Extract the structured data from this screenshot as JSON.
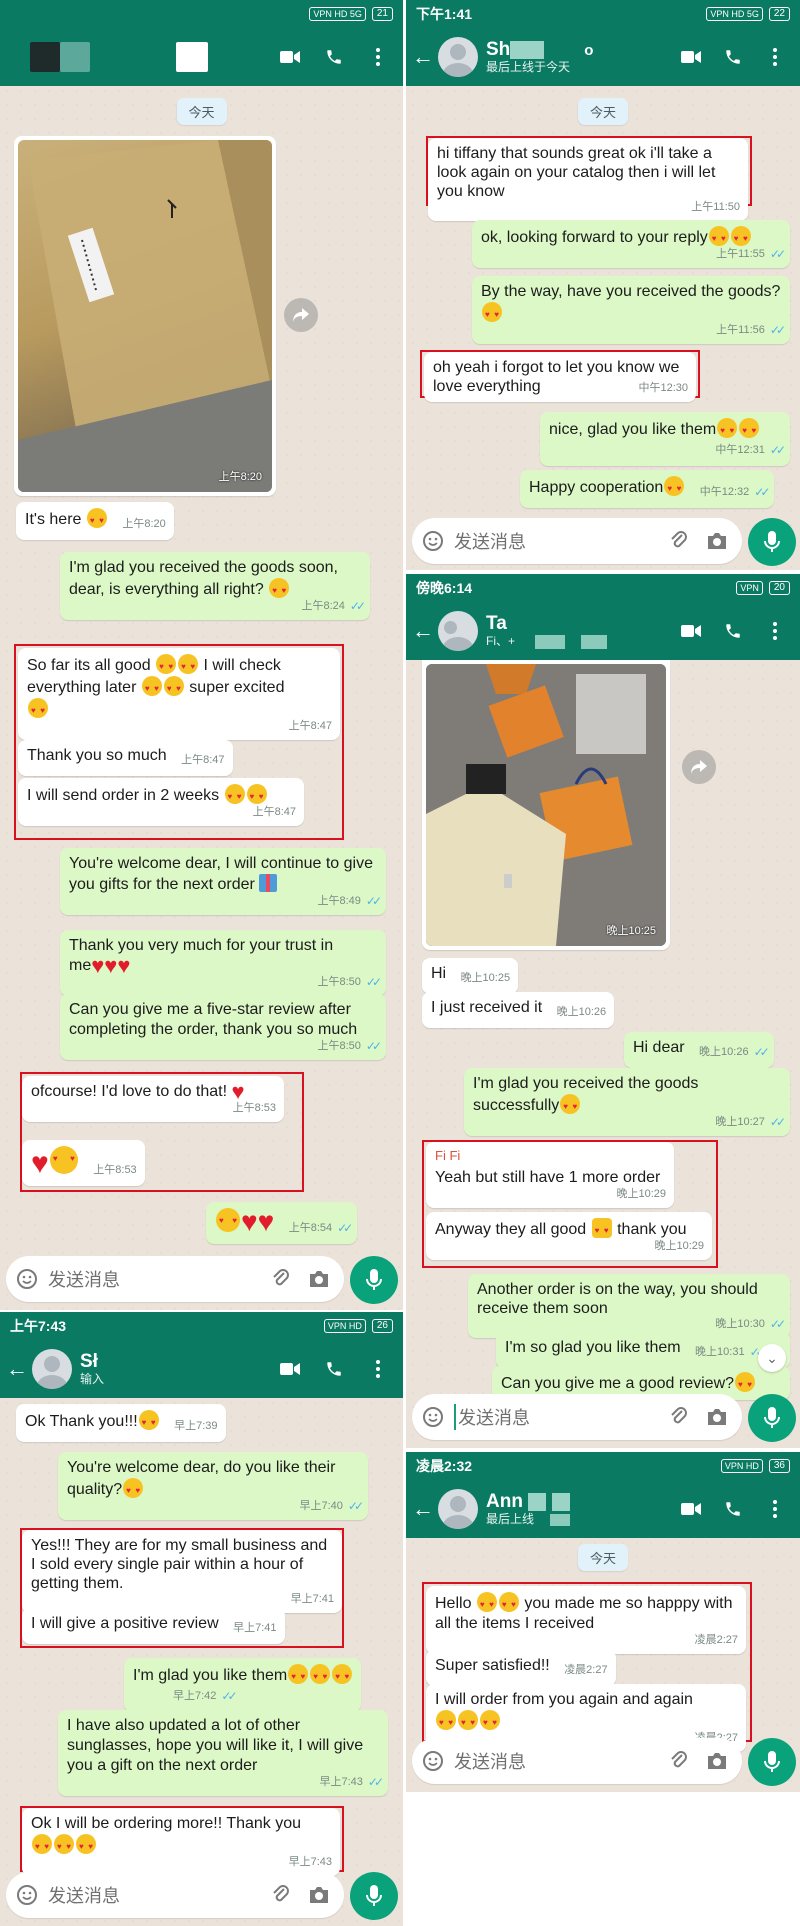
{
  "status_bars": {
    "p1": {
      "time": "",
      "icons": "VPN HD 5G",
      "battery": "21"
    },
    "p2": {
      "time": "下午1:41",
      "icons": "VPN HD 5G",
      "battery": "22"
    },
    "p3": {
      "time": "傍晚6:14",
      "icons": "VPN",
      "battery": "20"
    },
    "p4": {
      "time": "上午7:43",
      "icons": "VPN HD",
      "battery": "26"
    },
    "p5": {
      "time": "凌晨2:32",
      "icons": "VPN HD",
      "battery": "36"
    }
  },
  "headers": {
    "p2": {
      "name": "Sh",
      "status": "最后上线于今天",
      "suffix": "o"
    },
    "p3": {
      "name": "Ta",
      "status": "Fi、+"
    },
    "p4": {
      "name": "Sł",
      "status": "输入"
    },
    "p5": {
      "name": "Ann",
      "status": "最后上线"
    }
  },
  "day_labels": {
    "p1": "今天",
    "p2": "今天",
    "p5": "今天"
  },
  "input_placeholder": "发送消息",
  "panel1": {
    "image_time": "上午8:20",
    "messages": [
      {
        "text": "It's here",
        "time": "上午8:20"
      },
      {
        "text": "I'm glad you received the goods soon, dear, is everything all right?",
        "time": "上午8:24"
      },
      {
        "text": "So far its all good",
        "text2": "I will check everything later",
        "text3": "super excited",
        "time": "上午8:47"
      },
      {
        "text": "Thank you so much",
        "time": "上午8:47"
      },
      {
        "text": "I will send order in 2 weeks",
        "time": "上午8:47"
      },
      {
        "text": "You're welcome dear, I will continue to give you gifts for the next order",
        "time": "上午8:49"
      },
      {
        "text": "Thank you very much for your trust in me",
        "time": "上午8:50"
      },
      {
        "text": "Can you give me a five-star review after completing the order, thank you so much",
        "time": "上午8:50"
      },
      {
        "text": "ofcourse! I'd love to do that!",
        "time": "上午8:53"
      },
      {
        "text": "",
        "time": "上午8:53"
      },
      {
        "text": "",
        "time": "上午8:54"
      }
    ]
  },
  "panel2": {
    "messages": [
      {
        "text": "hi tiffany that sounds great ok i'll take a look again on your catalog then i will let you know",
        "time": "上午11:50"
      },
      {
        "text": "ok, looking forward to your reply",
        "time": "上午11:55"
      },
      {
        "text": "By the way, have you received the goods?",
        "time": "上午11:56"
      },
      {
        "text": "oh yeah i forgot to let you know we love everything",
        "time": "中午12:30"
      },
      {
        "text": "nice, glad you like them",
        "time": "中午12:31"
      },
      {
        "text": "Happy cooperation",
        "time": "中午12:32"
      }
    ]
  },
  "panel3": {
    "image_time": "晚上10:25",
    "messages": [
      {
        "text": "Hi",
        "time": "晚上10:25"
      },
      {
        "text": "I just received it",
        "time": "晚上10:26"
      },
      {
        "text": "Hi dear",
        "time": "晚上10:26"
      },
      {
        "text": "I'm glad you received the goods successfully",
        "time": "晚上10:27"
      },
      {
        "sender": "Fi Fi",
        "text": "Yeah but still have 1 more order",
        "time": "晚上10:29"
      },
      {
        "text": "Anyway they all good",
        "text2": "thank you",
        "time": "晚上10:29"
      },
      {
        "text": "Another order is on the way, you should receive them soon",
        "time": "晚上10:30"
      },
      {
        "text": "I'm so glad you like them",
        "time": "晚上10:31"
      },
      {
        "text": "Can you give me a good review?",
        "time": ""
      }
    ]
  },
  "panel4": {
    "messages": [
      {
        "text": "Ok Thank you!!!",
        "time": "早上7:39"
      },
      {
        "text": "You're welcome dear, do you like their quality?",
        "time": "早上7:40"
      },
      {
        "text": "Yes!!! They are for my small business and I sold every single pair within a hour of getting them.",
        "time": "早上7:41"
      },
      {
        "text": "I will give a positive review",
        "time": "早上7:41"
      },
      {
        "text": "I'm glad you like them",
        "time": "早上7:42"
      },
      {
        "text": "I have also updated a lot of other sunglasses, hope you will like it, I will give you a gift on the next order",
        "time": "早上7:43"
      },
      {
        "text": "Ok I will be ordering more!! Thank you",
        "time": "早上7:43"
      }
    ]
  },
  "panel5": {
    "messages": [
      {
        "text": "Hello",
        "text2": "you made me so happpy with all the items I received",
        "time": "凌晨2:27"
      },
      {
        "text": "Super satisfied!!",
        "time": "凌晨2:27"
      },
      {
        "text": "I will order from you again and again",
        "time": "凌晨2:27"
      }
    ]
  }
}
